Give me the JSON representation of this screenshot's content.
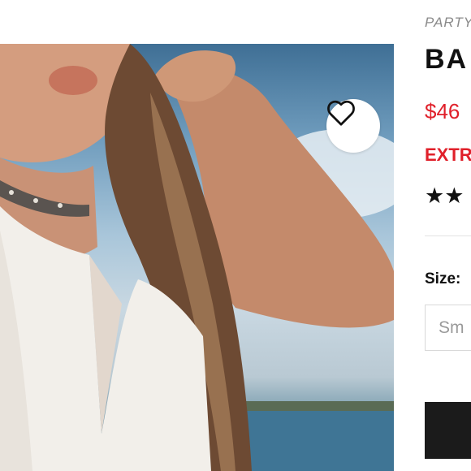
{
  "product": {
    "category": "PARTY",
    "title": "BA",
    "price": "$46",
    "promo": "EXTR",
    "rating": {
      "stars_shown": "★★"
    },
    "size": {
      "label": "Size:",
      "selected": "Sm"
    }
  },
  "icons": {
    "favorite": "heart-outline-icon"
  },
  "colors": {
    "accent_red": "#e0202a",
    "text_dark": "#111111",
    "button_dark": "#1b1b1b"
  }
}
